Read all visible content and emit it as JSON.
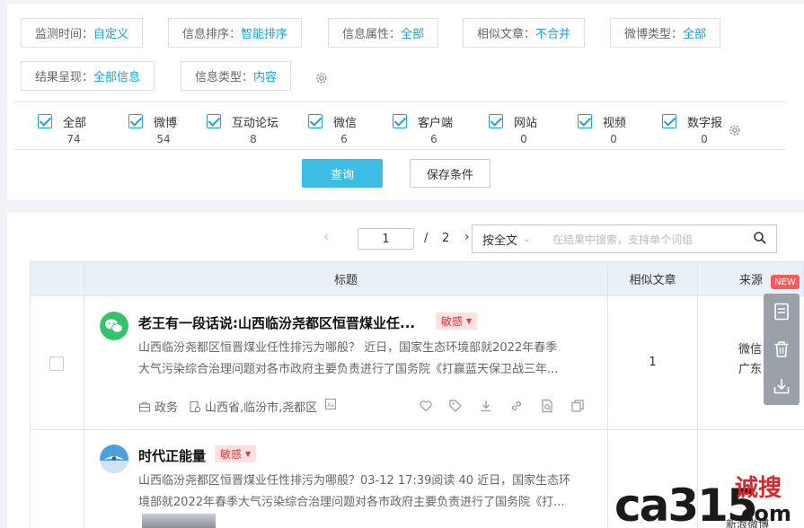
{
  "filters": {
    "row1": [
      {
        "label": "监测时间：",
        "value": "自定义"
      },
      {
        "label": "信息排序：",
        "value": "智能排序"
      },
      {
        "label": "信息属性：",
        "value": "全部"
      },
      {
        "label": "相似文章：",
        "value": "不合并"
      },
      {
        "label": "微博类型：",
        "value": "全部"
      }
    ],
    "row2": [
      {
        "label": "结果呈现：",
        "value": "全部信息"
      },
      {
        "label": "信息类型：",
        "value": "内容"
      }
    ]
  },
  "categories": [
    {
      "label": "全部",
      "count": "74",
      "checked": true
    },
    {
      "label": "微博",
      "count": "54",
      "checked": true
    },
    {
      "label": "互动论坛",
      "count": "8",
      "checked": true
    },
    {
      "label": "微信",
      "count": "6",
      "checked": true
    },
    {
      "label": "客户端",
      "count": "6",
      "checked": true
    },
    {
      "label": "网站",
      "count": "0",
      "checked": true
    },
    {
      "label": "视频",
      "count": "0",
      "checked": true
    },
    {
      "label": "数字报",
      "count": "0",
      "checked": true
    }
  ],
  "actions": {
    "query": "查询",
    "save": "保存条件"
  },
  "pager": {
    "prev": "‹",
    "current": "1",
    "sep": "/",
    "total": "2",
    "next": "›"
  },
  "scope": {
    "value": "按全文",
    "chevron": "⌄"
  },
  "search": {
    "placeholder": "在结果中搜索，支持单个词组"
  },
  "table": {
    "headers": {
      "title": "标题",
      "similar": "相似文章",
      "source": "来源"
    },
    "rows": [
      {
        "title": "老王有一段话说:山西临汾尧都区恒晋煤业任...",
        "badge": "敏感",
        "summary1": "山西临汾尧都区恒晋煤业任性排污为哪般？ 近日，国家生态环境部就2022年春季",
        "summary2": "大气污染综合治理问题对各市政府主要负责进行了国务院《打赢蓝天保卫战三年...",
        "category": "政务",
        "location": "山西省,临汾市,尧都区",
        "similar": "1",
        "source1": "微信",
        "source2": "广东"
      },
      {
        "title": "时代正能量",
        "badge": "敏感",
        "summary1": "山西临汾尧都区恒晋煤业任性排污为哪般？03-12 17:39阅读 40 近日，国家生态环",
        "summary2": "境部就2022年春季大气污染综合治理问题对各市政府主要负责进行了国务院《打...",
        "source1": "新浪微博"
      }
    ]
  },
  "float": {
    "new_label": "NEW"
  },
  "watermark": {
    "brand": "ca315",
    "cn": "诚搜",
    "suffix": ".com"
  },
  "colors": {
    "accent": "#1aa3d6",
    "button": "#3dbde3",
    "badge_text": "#e0393e",
    "badge_bg": "#fde2e2",
    "wechat": "#36c26b"
  }
}
